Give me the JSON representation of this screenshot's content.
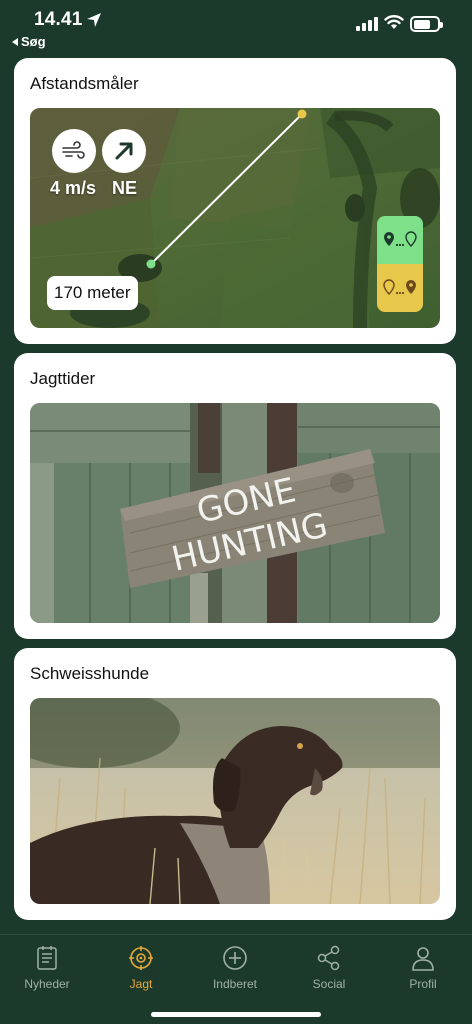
{
  "status_bar": {
    "time": "14.41",
    "back_label": "Søg"
  },
  "cards": {
    "distance": {
      "title": "Afstandsmåler",
      "wind_speed": "4 m/s",
      "wind_direction": "NE",
      "distance_label": "170 meter",
      "toggle_colors": [
        "#7fe08a",
        "#e7c84a"
      ]
    },
    "hunting_times": {
      "title": "Jagttider",
      "sign_text_line1": "GONE",
      "sign_text_line2": "HUNTING"
    },
    "tracking_dogs": {
      "title": "Schweisshunde"
    }
  },
  "tab_bar": {
    "tabs": [
      {
        "label": "Nyheder",
        "icon": "news-icon"
      },
      {
        "label": "Jagt",
        "icon": "target-icon",
        "active": true
      },
      {
        "label": "Indberet",
        "icon": "plus-circle-icon"
      },
      {
        "label": "Social",
        "icon": "share-icon"
      },
      {
        "label": "Profil",
        "icon": "person-icon"
      }
    ]
  },
  "colors": {
    "background": "#1c3a2c",
    "active_tab": "#e6a83a",
    "inactive_tab": "#9fb1a7"
  }
}
